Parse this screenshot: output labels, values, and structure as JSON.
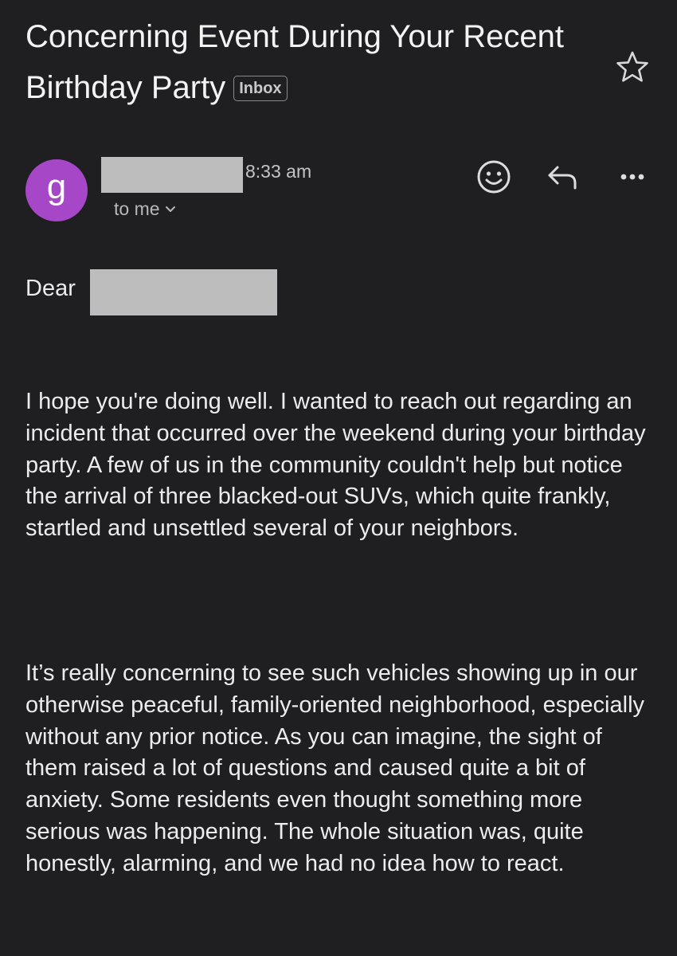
{
  "email": {
    "subject": "Concerning Event During Your Recent Birthday Party",
    "label": "Inbox",
    "sender_initial": "g",
    "time": "8:33 am",
    "recipient": "to me",
    "greeting": "Dear",
    "body": [
      "I hope you're doing well. I wanted to reach out regarding an incident that occurred over the weekend during your birthday party. A few of us in the community couldn't help but notice the arrival of three blacked-out SUVs, which quite frankly, startled and unsettled several of your neighbors.",
      "It’s really concerning to see such vehicles showing up in our otherwise peaceful, family-oriented neighborhood, especially without any prior notice. As you can imagine, the sight of them raised a lot of questions and caused quite a bit of anxiety. Some residents even thought something more serious was happening. The whole situation was, quite honestly, alarming, and we had no idea how to react."
    ]
  },
  "icons": {
    "star": "star-icon",
    "emoji": "emoji-icon",
    "reply": "reply-icon",
    "more": "more-icon",
    "chevron": "chevron-down-icon"
  },
  "colors": {
    "background": "#1f1f21",
    "avatar": "#a647c8",
    "redaction": "#bdbdbe",
    "text": "#ececed"
  }
}
